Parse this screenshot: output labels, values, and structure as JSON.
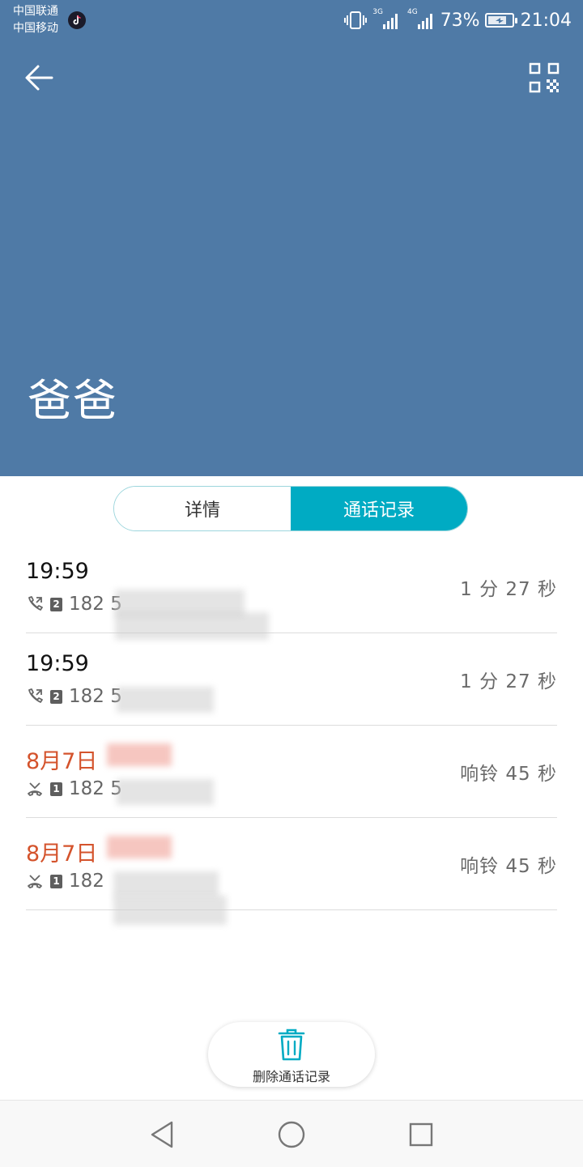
{
  "status_bar": {
    "carrier_1": "中国联通",
    "carrier_2": "中国移动",
    "net_1": "3G",
    "net_2": "4G",
    "battery": "73%",
    "time": "21:04"
  },
  "header": {
    "background": "#4f7aa6",
    "contact_name": "爸爸",
    "back_icon": "arrow-left-icon",
    "qr_icon": "qr-code-icon"
  },
  "tabs": [
    {
      "label": "详情",
      "active": false
    },
    {
      "label": "通话记录",
      "active": true
    }
  ],
  "accent_color": "#00abc3",
  "calls": [
    {
      "time": "19:59",
      "type": "outgoing",
      "sim": "2",
      "number": "182 5",
      "duration": "1 分 27 秒"
    },
    {
      "time": "19:59",
      "type": "outgoing",
      "sim": "2",
      "number": "182 5",
      "duration": "1 分 27 秒"
    },
    {
      "time": "8月7日",
      "type": "missed",
      "sim": "1",
      "number": "182 5",
      "duration": "响铃 45 秒"
    },
    {
      "time": "8月7日",
      "type": "missed",
      "sim": "1",
      "number": "182",
      "duration": "响铃 45 秒"
    }
  ],
  "missed_color": "#d4532c",
  "delete_button": {
    "label": "删除通话记录",
    "icon": "trash-icon"
  },
  "navbar": {
    "back": "nav-back-icon",
    "home": "nav-home-icon",
    "recents": "nav-recents-icon"
  }
}
